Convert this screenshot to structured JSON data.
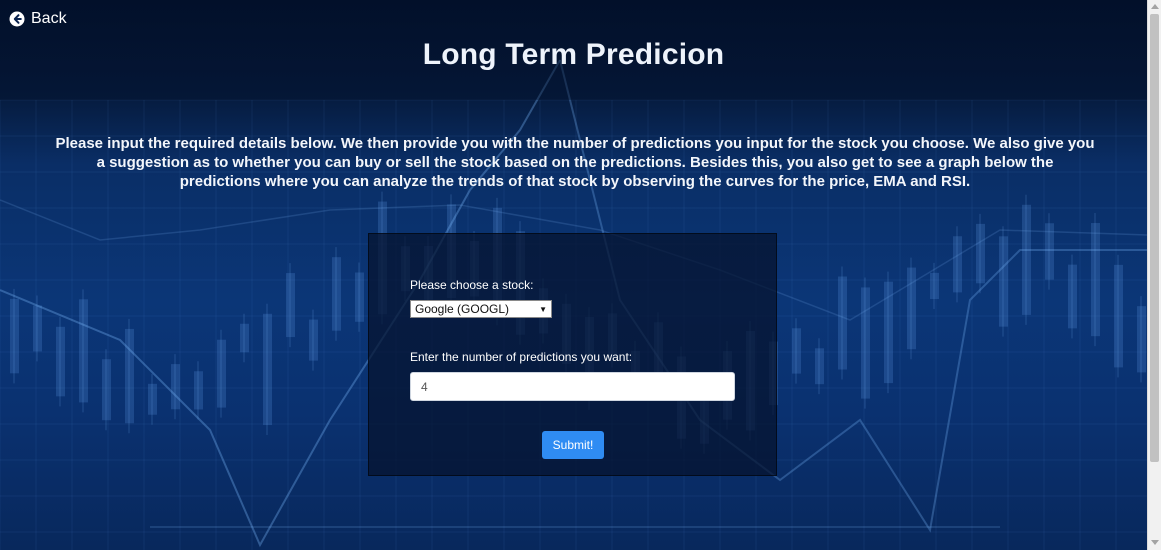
{
  "nav": {
    "back_label": "Back",
    "back_icon": "circle-arrow-left-icon"
  },
  "page": {
    "title": "Long Term Predicion",
    "intro": "Please input the required details below. We then provide you with the number of predictions you input for the stock you choose. We also give you a suggestion as to whether you can buy or sell the stock based on the predictions. Besides this, you also get to see a graph below the predictions where you can analyze the trends of that stock by observing the curves for the price, EMA and RSI."
  },
  "form": {
    "stock_label": "Please choose a stock:",
    "stock_selected": "Google (GOOGL)",
    "predictions_label": "Enter the number of predictions you want:",
    "predictions_value": "4",
    "submit_label": "Submit!"
  },
  "colors": {
    "background": "#0b3677",
    "panel": "#05122d",
    "accent": "#2f8cf3"
  }
}
